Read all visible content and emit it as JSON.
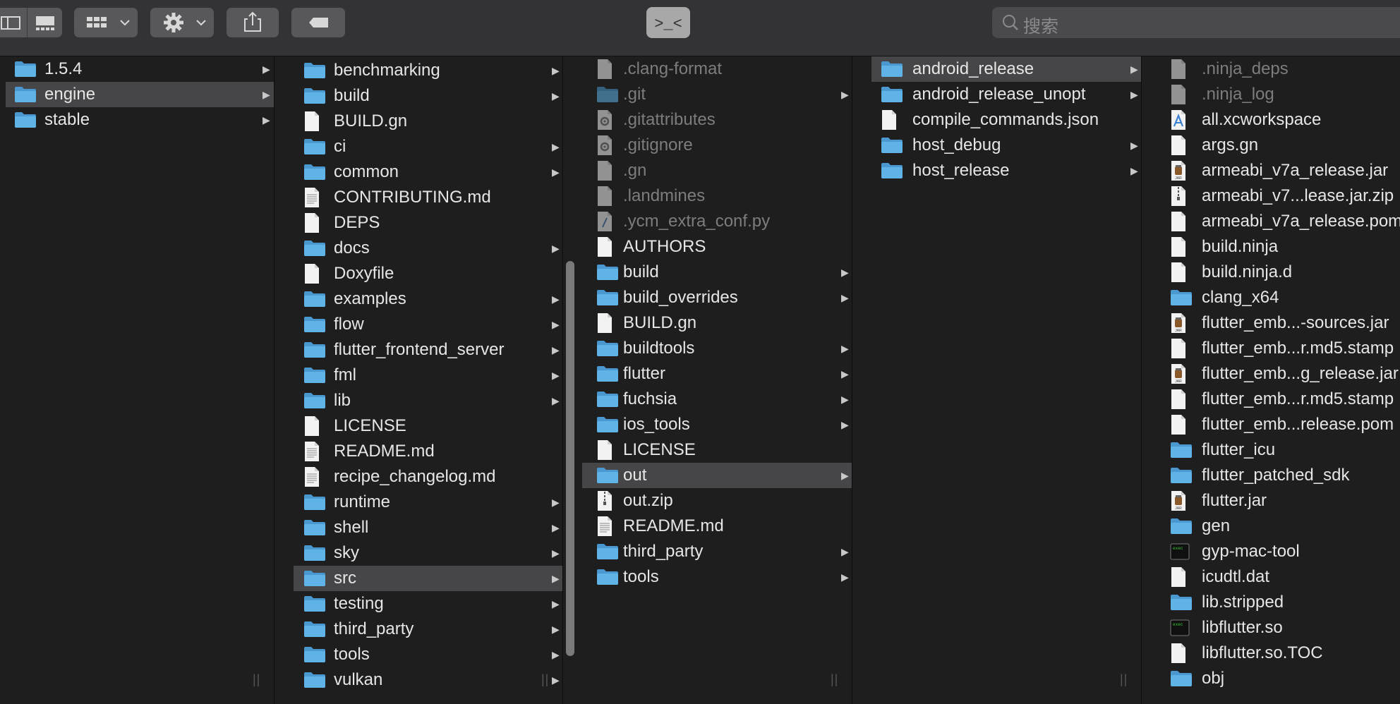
{
  "toolbar": {
    "search": {
      "placeholder": "搜索",
      "icon": "search-icon"
    },
    "terminal_glyph": ">_<"
  },
  "columns": [
    {
      "items": [
        {
          "label": "1.5.4",
          "icon": "folder",
          "has_children": true
        },
        {
          "label": "engine",
          "icon": "folder",
          "has_children": true,
          "selected": true
        },
        {
          "label": "stable",
          "icon": "folder",
          "has_children": true
        }
      ]
    },
    {
      "items": [
        {
          "label": "benchmarking",
          "icon": "folder",
          "has_children": true
        },
        {
          "label": "build",
          "icon": "folder",
          "has_children": true
        },
        {
          "label": "BUILD.gn",
          "icon": "file"
        },
        {
          "label": "ci",
          "icon": "folder",
          "has_children": true
        },
        {
          "label": "common",
          "icon": "folder",
          "has_children": true
        },
        {
          "label": "CONTRIBUTING.md",
          "icon": "text"
        },
        {
          "label": "DEPS",
          "icon": "file"
        },
        {
          "label": "docs",
          "icon": "folder",
          "has_children": true
        },
        {
          "label": "Doxyfile",
          "icon": "file"
        },
        {
          "label": "examples",
          "icon": "folder",
          "has_children": true
        },
        {
          "label": "flow",
          "icon": "folder",
          "has_children": true
        },
        {
          "label": "flutter_frontend_server",
          "icon": "folder",
          "has_children": true
        },
        {
          "label": "fml",
          "icon": "folder",
          "has_children": true
        },
        {
          "label": "lib",
          "icon": "folder",
          "has_children": true
        },
        {
          "label": "LICENSE",
          "icon": "file"
        },
        {
          "label": "README.md",
          "icon": "text"
        },
        {
          "label": "recipe_changelog.md",
          "icon": "text"
        },
        {
          "label": "runtime",
          "icon": "folder",
          "has_children": true
        },
        {
          "label": "shell",
          "icon": "folder",
          "has_children": true
        },
        {
          "label": "sky",
          "icon": "folder",
          "has_children": true
        },
        {
          "label": "src",
          "icon": "folder",
          "has_children": true,
          "selected": true
        },
        {
          "label": "testing",
          "icon": "folder",
          "has_children": true
        },
        {
          "label": "third_party",
          "icon": "folder",
          "has_children": true
        },
        {
          "label": "tools",
          "icon": "folder",
          "has_children": true
        },
        {
          "label": "vulkan",
          "icon": "folder",
          "has_children": true
        }
      ]
    },
    {
      "items": [
        {
          "label": ".clang-format",
          "icon": "file",
          "hidden": true
        },
        {
          "label": ".git",
          "icon": "folder",
          "hidden": true,
          "has_children": true
        },
        {
          "label": ".gitattributes",
          "icon": "gear-file",
          "hidden": true
        },
        {
          "label": ".gitignore",
          "icon": "gear-file",
          "hidden": true
        },
        {
          "label": ".gn",
          "icon": "file",
          "hidden": true
        },
        {
          "label": ".landmines",
          "icon": "file",
          "hidden": true
        },
        {
          "label": ".ycm_extra_conf.py",
          "icon": "script",
          "hidden": true
        },
        {
          "label": "AUTHORS",
          "icon": "file"
        },
        {
          "label": "build",
          "icon": "folder",
          "has_children": true
        },
        {
          "label": "build_overrides",
          "icon": "folder",
          "has_children": true
        },
        {
          "label": "BUILD.gn",
          "icon": "file"
        },
        {
          "label": "buildtools",
          "icon": "folder",
          "has_children": true
        },
        {
          "label": "flutter",
          "icon": "folder",
          "has_children": true
        },
        {
          "label": "fuchsia",
          "icon": "folder",
          "has_children": true
        },
        {
          "label": "ios_tools",
          "icon": "folder",
          "has_children": true
        },
        {
          "label": "LICENSE",
          "icon": "file"
        },
        {
          "label": "out",
          "icon": "folder",
          "has_children": true,
          "selected": true
        },
        {
          "label": "out.zip",
          "icon": "zip"
        },
        {
          "label": "README.md",
          "icon": "text"
        },
        {
          "label": "third_party",
          "icon": "folder",
          "has_children": true
        },
        {
          "label": "tools",
          "icon": "folder",
          "has_children": true
        }
      ]
    },
    {
      "items": [
        {
          "label": "android_release",
          "icon": "folder",
          "has_children": true,
          "selected": true
        },
        {
          "label": "android_release_unopt",
          "icon": "folder",
          "has_children": true
        },
        {
          "label": "compile_commands.json",
          "icon": "file"
        },
        {
          "label": "host_debug",
          "icon": "folder",
          "has_children": true
        },
        {
          "label": "host_release",
          "icon": "folder",
          "has_children": true
        }
      ]
    },
    {
      "items": [
        {
          "label": ".ninja_deps",
          "icon": "file",
          "hidden": true
        },
        {
          "label": ".ninja_log",
          "icon": "file",
          "hidden": true
        },
        {
          "label": "all.xcworkspace",
          "icon": "xcworkspace"
        },
        {
          "label": "args.gn",
          "icon": "file"
        },
        {
          "label": "armeabi_v7a_release.jar",
          "icon": "jar"
        },
        {
          "label": "armeabi_v7...lease.jar.zip",
          "icon": "zip"
        },
        {
          "label": "armeabi_v7a_release.pom",
          "icon": "file"
        },
        {
          "label": "build.ninja",
          "icon": "file"
        },
        {
          "label": "build.ninja.d",
          "icon": "file"
        },
        {
          "label": "clang_x64",
          "icon": "folder"
        },
        {
          "label": "flutter_emb...-sources.jar",
          "icon": "jar"
        },
        {
          "label": "flutter_emb...r.md5.stamp",
          "icon": "file"
        },
        {
          "label": "flutter_emb...g_release.jar",
          "icon": "jar"
        },
        {
          "label": "flutter_emb...r.md5.stamp",
          "icon": "file"
        },
        {
          "label": "flutter_emb...release.pom",
          "icon": "file"
        },
        {
          "label": "flutter_icu",
          "icon": "folder"
        },
        {
          "label": "flutter_patched_sdk",
          "icon": "folder"
        },
        {
          "label": "flutter.jar",
          "icon": "jar"
        },
        {
          "label": "gen",
          "icon": "folder"
        },
        {
          "label": "gyp-mac-tool",
          "icon": "exec"
        },
        {
          "label": "icudtl.dat",
          "icon": "file"
        },
        {
          "label": "lib.stripped",
          "icon": "folder"
        },
        {
          "label": "libflutter.so",
          "icon": "exec"
        },
        {
          "label": "libflutter.so.TOC",
          "icon": "file"
        },
        {
          "label": "obj",
          "icon": "folder"
        }
      ]
    }
  ],
  "colors": {
    "folder": "#5fb3e6",
    "selection": "#464648",
    "hidden_text": "#7d7d7d"
  }
}
